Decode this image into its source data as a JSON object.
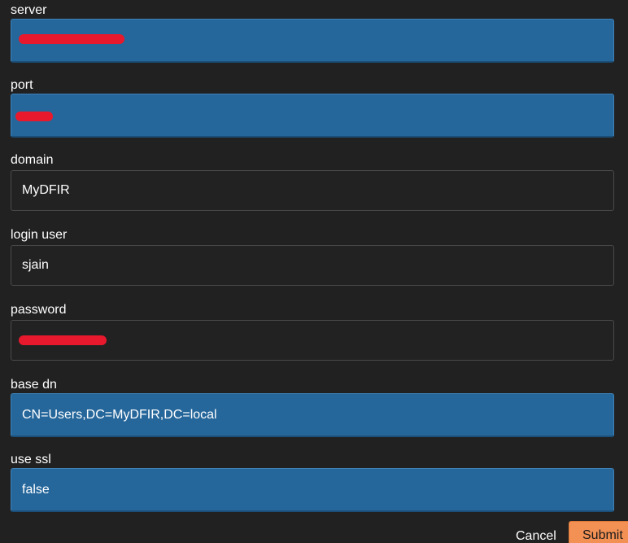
{
  "fields": {
    "server": {
      "label": "server",
      "value": ""
    },
    "port": {
      "label": "port",
      "value": ""
    },
    "domain": {
      "label": "domain",
      "value": "MyDFIR"
    },
    "login_user": {
      "label": "login user",
      "value": "sjain"
    },
    "password": {
      "label": "password",
      "value": ""
    },
    "base_dn": {
      "label": "base dn",
      "value": "CN=Users,DC=MyDFIR,DC=local"
    },
    "use_ssl": {
      "label": "use ssl",
      "value": "false"
    }
  },
  "actions": {
    "cancel_label": "Cancel",
    "submit_label": "Submit"
  },
  "colors": {
    "background": "#212121",
    "filled_input": "#26679b",
    "redaction": "#e8192c",
    "submit_button": "#f39154"
  }
}
